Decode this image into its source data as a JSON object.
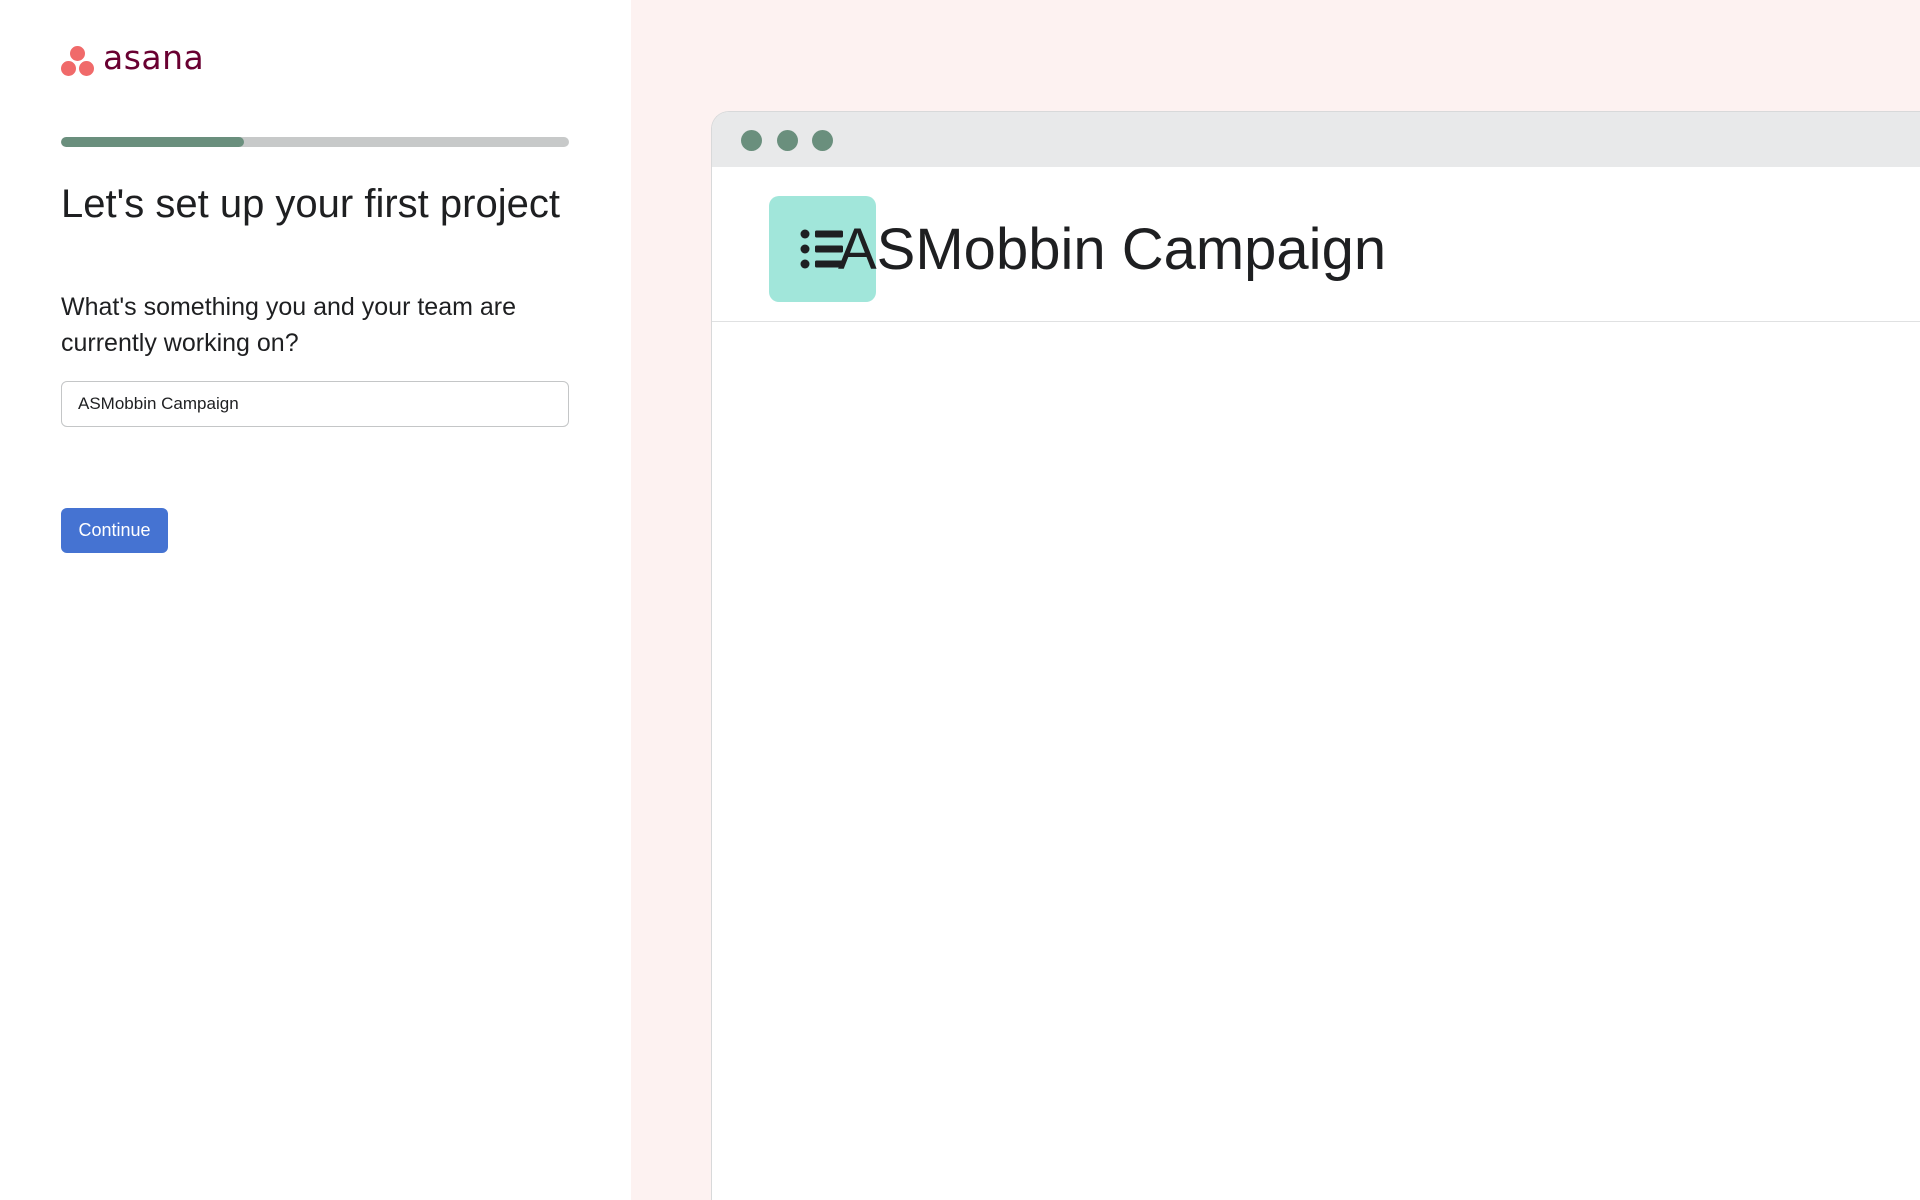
{
  "brand": {
    "name": "asana",
    "logo_color": "#f06a6a",
    "text_color": "#690031"
  },
  "progress": {
    "fraction": 0.36,
    "fill_color": "#6a8f7d",
    "track_color": "#c7c9c9"
  },
  "form": {
    "heading": "Let's set up your first project",
    "question": "What's something you and your team are currently working on?",
    "project_name_value": "ASMobbin Campaign",
    "continue_label": "Continue",
    "button_color": "#4573d2"
  },
  "preview": {
    "background": "#fdf2f1",
    "project_title": "ASMobbin Campaign",
    "project_icon": "list-icon",
    "project_icon_color": "#a1e6da",
    "window_dots": [
      "close-dot",
      "minimize-dot",
      "maximize-dot"
    ]
  }
}
